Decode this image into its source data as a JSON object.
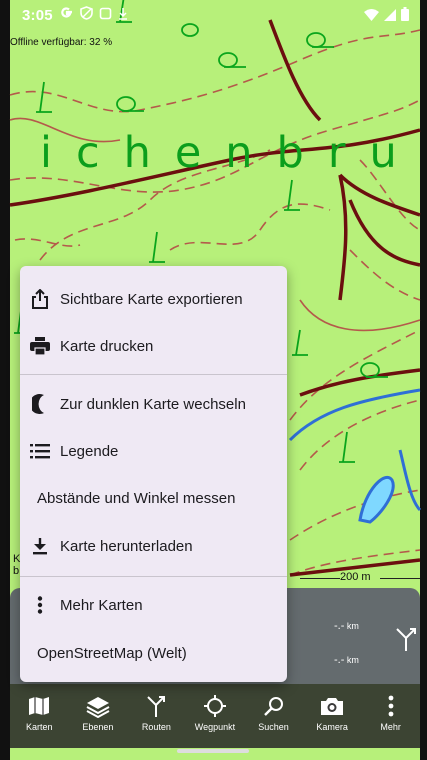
{
  "status_bar": {
    "time": "3:05",
    "icons": [
      "google-g-icon",
      "shield-icon",
      "screen-icon",
      "download-arrow-icon"
    ],
    "right_icons": [
      "wifi-icon",
      "signal-icon",
      "battery-icon"
    ]
  },
  "map": {
    "offline_label": "Offline verfügbar: 32 %",
    "place_name": "ichenbru",
    "scale_left_label_1": "K",
    "scale_left_label_2": "b",
    "scale_value": "200 m",
    "colors": {
      "background": "#b7f07a",
      "contour": "#b45a4b",
      "road": "#6b0f0f",
      "water": "#2f6fd6",
      "symbol": "#0aa51c"
    }
  },
  "menu": {
    "items": [
      {
        "label": "Sichtbare Karte exportieren",
        "icon": "share-icon"
      },
      {
        "label": "Karte drucken",
        "icon": "printer-icon"
      },
      {
        "label": "Zur dunklen Karte wechseln",
        "icon": "moon-icon"
      },
      {
        "label": "Legende",
        "icon": "list-icon"
      },
      {
        "label": "Abstände und Winkel messen",
        "icon": ""
      },
      {
        "label": "Karte herunterladen",
        "icon": "download-icon"
      },
      {
        "label": "Mehr Karten",
        "icon": "more-vertical-icon"
      },
      {
        "label": "OpenStreetMap (Welt)",
        "icon": ""
      }
    ]
  },
  "info_panel": {
    "dist1_value": "-.-",
    "dist1_unit": "km",
    "dist2_value": "-.-",
    "dist2_unit": "km"
  },
  "bottom_nav": {
    "items": [
      {
        "label": "Karten",
        "icon": "map-icon"
      },
      {
        "label": "Ebenen",
        "icon": "layers-icon"
      },
      {
        "label": "Routen",
        "icon": "route-icon"
      },
      {
        "label": "Wegpunkt",
        "icon": "crosshair-icon"
      },
      {
        "label": "Suchen",
        "icon": "search-icon"
      },
      {
        "label": "Kamera",
        "icon": "camera-icon"
      },
      {
        "label": "Mehr",
        "icon": "more-vertical-icon"
      }
    ]
  }
}
